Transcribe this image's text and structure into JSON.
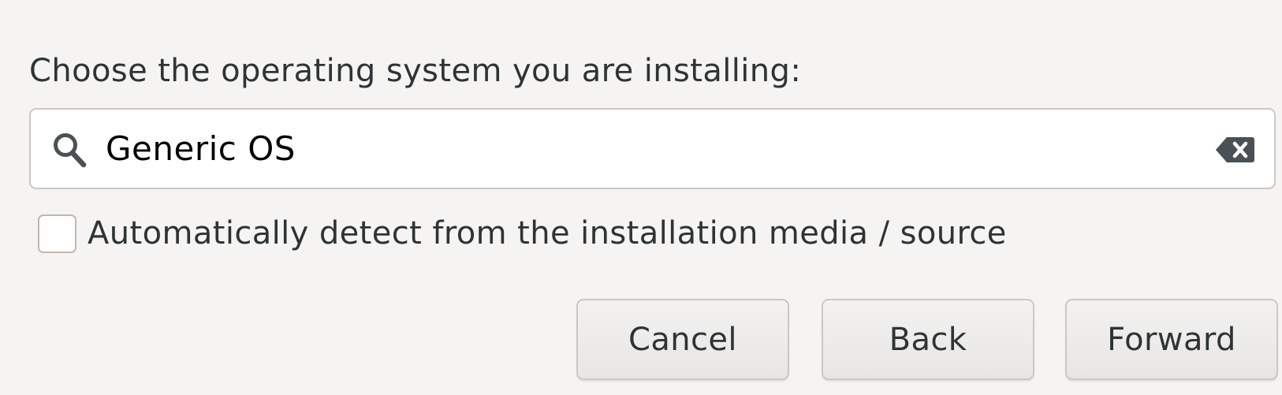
{
  "prompt": {
    "label": "Choose the operating system you are installing:"
  },
  "search": {
    "value": "Generic OS",
    "icon": "search-icon",
    "clear_icon": "clear-entry-icon"
  },
  "auto_detect": {
    "label": "Automatically detect from the installation media / source",
    "checked": false
  },
  "buttons": {
    "cancel": "Cancel",
    "back": "Back",
    "forward": "Forward"
  },
  "colors": {
    "background": "#f5f4f3",
    "text": "#2e3436",
    "border": "#cdc7c2",
    "icon": "#4a5154"
  }
}
